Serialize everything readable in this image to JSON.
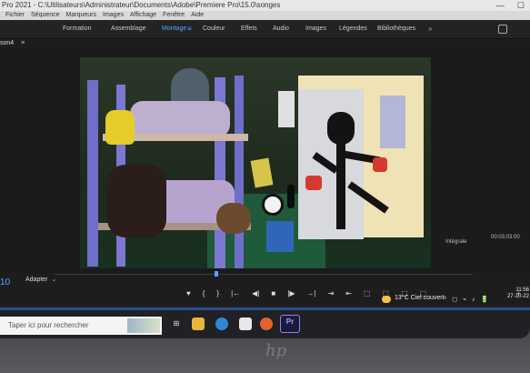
{
  "titlebar": {
    "title": "Pro 2021 - C:\\Utilisateurs\\Administrateur\\Documents\\Adobe\\Premiere Pro\\15.0\\songes",
    "window_controls": [
      "—",
      "☐"
    ]
  },
  "menubar": {
    "items": [
      "Fichier",
      "Séquence",
      "Marqueurs",
      "Images",
      "Affichage",
      "Fenêtre",
      "Aide"
    ]
  },
  "workspace": {
    "tabs": [
      "Formation",
      "Assemblage",
      "Montage",
      "Couleur",
      "Effets",
      "Audio",
      "Images",
      "Légendes",
      "Bibliothèques"
    ],
    "active": "Montage",
    "menu_glyph": "≡",
    "more_glyph": "»"
  },
  "panel": {
    "tab_label": "son4",
    "menu_glyph": "≡"
  },
  "monitor": {
    "resolution": "Intégrale",
    "timecode_right": "00:03:03:00",
    "timecode_left": "10",
    "fit": "Adapter"
  },
  "controls": {
    "buttons": [
      "♥",
      "{",
      "}",
      "|←",
      "◀|",
      "■",
      "|▶",
      "→|",
      "⇥",
      "⇤",
      "⬚",
      "⬚",
      "⬚",
      "⬚"
    ]
  },
  "tray": {
    "temperature": "13°C",
    "weather": "Ciel couvert",
    "icons": "^ ◻ ⌁ ♪ 🔋",
    "time": "11:56",
    "date": "27-10-22"
  },
  "taskbar": {
    "search_placeholder": "Taper ici pour rechercher",
    "premiere_label": "Pr"
  },
  "hardware": {
    "brand": "hp"
  },
  "colors": {
    "accent": "#5aa2ff",
    "premiere": "#9a7bf5"
  }
}
